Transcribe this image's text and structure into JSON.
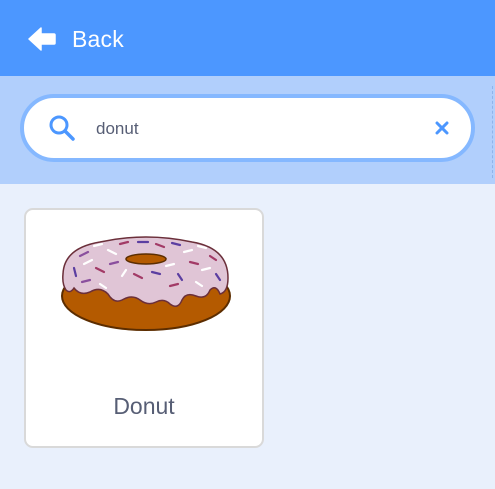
{
  "header": {
    "back_label": "Back",
    "back_icon": "arrow-left-icon"
  },
  "search": {
    "value": "donut",
    "search_icon": "search-icon",
    "clear_icon": "close-icon"
  },
  "results": [
    {
      "label": "Donut",
      "image": "donut-sprite"
    }
  ],
  "colors": {
    "header": "#4c97ff",
    "search_band": "#b1cffc",
    "page_background": "#e9f0fc",
    "accent": "#4c97ff"
  }
}
